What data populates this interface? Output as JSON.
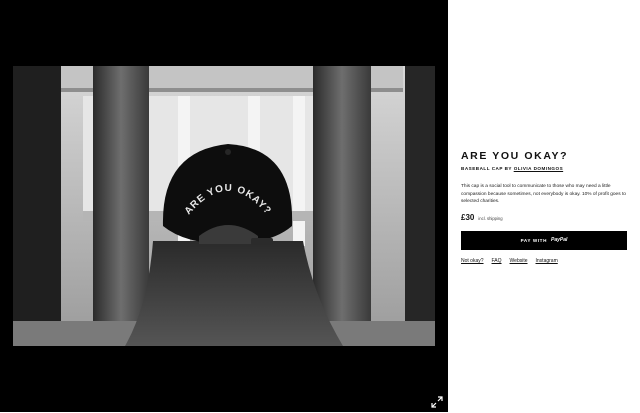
{
  "product": {
    "title": "ARE YOU OKAY?",
    "subtitle_prefix": "BASEBALL CAP BY",
    "author": "OLIVIA DOMINGOS",
    "description": "This cap is a social tool to communicate to those who may need a little compassion because sometimes, not everybody is okay. 10% of profit goes to selected charities.",
    "price": "£30",
    "shipping_note": "incl. shipping",
    "pay_label": "PAY WITH",
    "pay_brand": "PayPal",
    "cap_text": "ARE YOU OKAY?"
  },
  "links": [
    {
      "label": "Not okay?"
    },
    {
      "label": "FAQ"
    },
    {
      "label": "Website"
    },
    {
      "label": "Instagram"
    }
  ],
  "icons": {
    "expand": "expand-icon"
  }
}
